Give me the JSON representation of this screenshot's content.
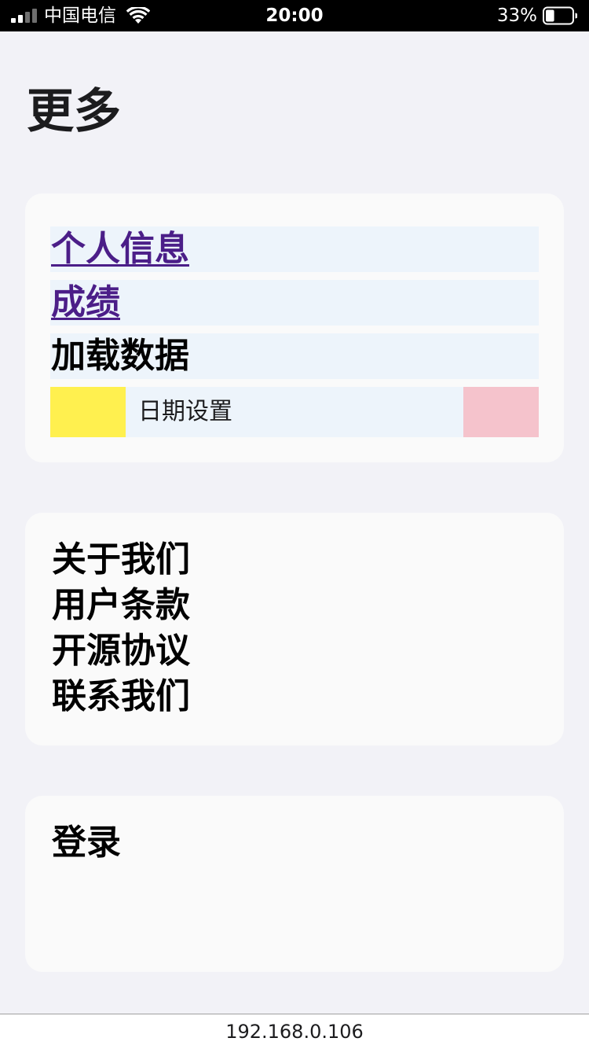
{
  "status_bar": {
    "carrier": "中国电信",
    "time": "20:00",
    "battery_percent": "33%",
    "battery_level": 0.33,
    "signal_bars_active": 2,
    "signal_bars_total": 4
  },
  "page": {
    "title": "更多"
  },
  "section_user": {
    "profile_label": "个人信息",
    "grades_label": "成绩",
    "load_data_label": "加载数据",
    "date_settings_label": "日期设置"
  },
  "section_about": {
    "about_label": "关于我们",
    "terms_label": "用户条款",
    "license_label": "开源协议",
    "contact_label": "联系我们"
  },
  "section_account": {
    "login_label": "登录"
  },
  "address_bar": {
    "url": "192.168.0.106"
  },
  "colors": {
    "background": "#f2f2f7",
    "card": "#fafafa",
    "row_highlight": "#edf4fb",
    "link": "#4b1e88",
    "yellow_swatch": "#fff04f",
    "pink_swatch": "#f5c3cc"
  },
  "icons": [
    "signal-icon",
    "wifi-icon",
    "battery-icon"
  ]
}
